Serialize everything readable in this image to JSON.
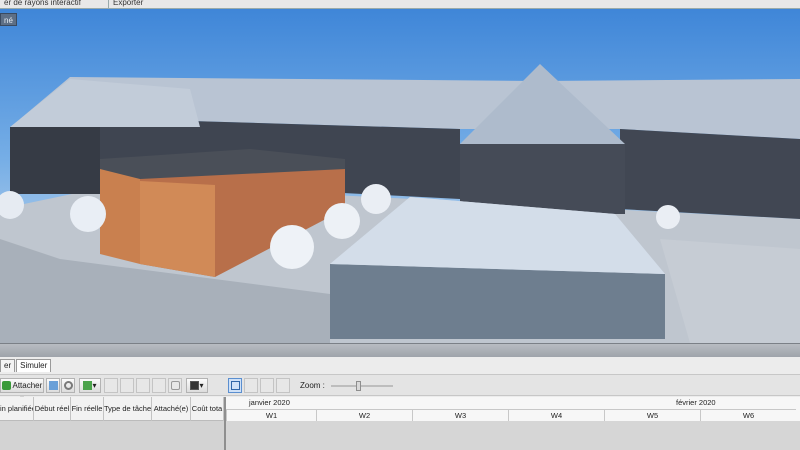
{
  "top_tabs": [
    "er de rayons interactif",
    "Exporter"
  ],
  "viewport": {
    "badge": "né"
  },
  "panel": {
    "tabs": [
      {
        "label": "er",
        "active": false
      },
      {
        "label": "Simuler",
        "active": true
      }
    ],
    "toolbar": {
      "attach_label": "Attacher",
      "zoom_label": "Zoom :"
    },
    "columns": [
      "in planifiée",
      "Début réel",
      "Fin réelle",
      "Type de tâche",
      "Attaché(e)",
      "Coût tota"
    ],
    "gantt": {
      "months": [
        "janvier 2020",
        "février 2020"
      ],
      "weeks": [
        "W1",
        "W2",
        "W3",
        "W4",
        "W5",
        "W6"
      ]
    }
  },
  "colors": {
    "sky_top": "#3f86d8",
    "roof": "#b7c3d3",
    "facade_dark": "#3e4450",
    "orange": "#c7784f",
    "ground": "#b9c0ca"
  }
}
